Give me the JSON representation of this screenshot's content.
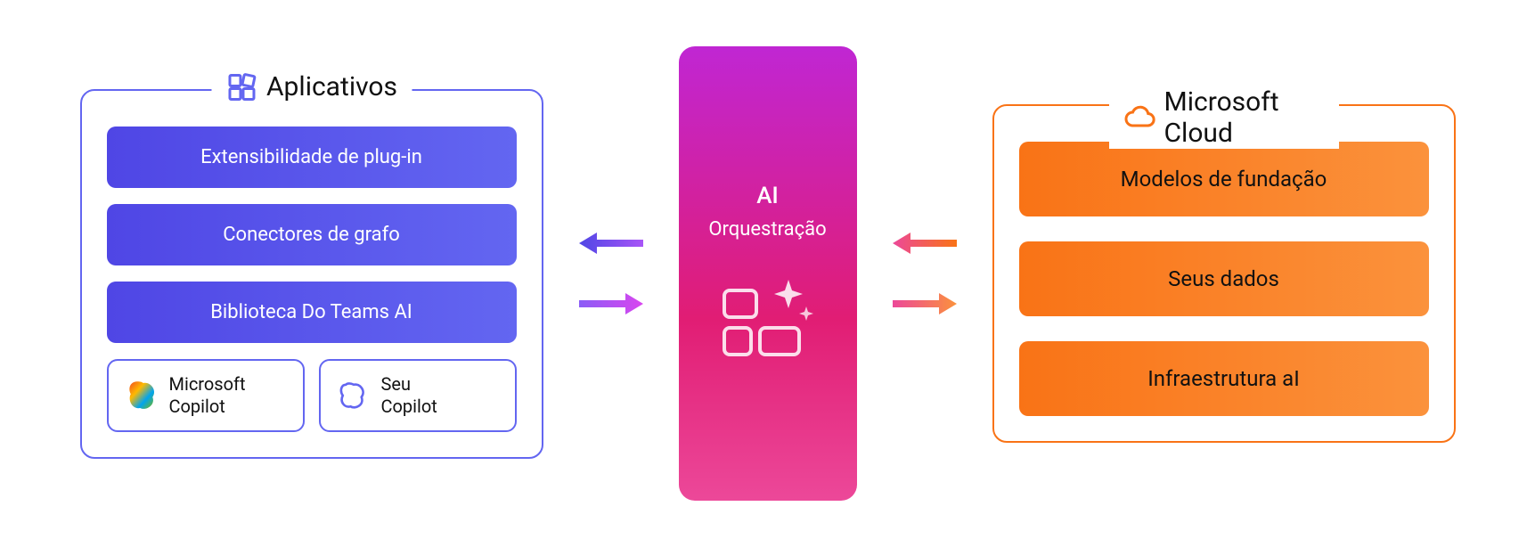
{
  "apps": {
    "title": "Aplicativos",
    "items": [
      "Extensibilidade de plug-in",
      "Conectores de grafo",
      "Biblioteca Do Teams AI"
    ],
    "copilot_left_top": "Microsoft",
    "copilot_left_bottom": "Copilot",
    "copilot_right_top": "Seu",
    "copilot_right_bottom": "Copilot"
  },
  "center": {
    "title": "AI",
    "subtitle": "Orquestração"
  },
  "cloud": {
    "title": "Microsoft Cloud",
    "items": [
      "Modelos de fundação",
      "Seus dados",
      "Infraestrutura aI"
    ]
  },
  "colors": {
    "blue": "#6366f1",
    "orange": "#f97316",
    "magenta": "#c026d3",
    "pink": "#ec4899"
  }
}
